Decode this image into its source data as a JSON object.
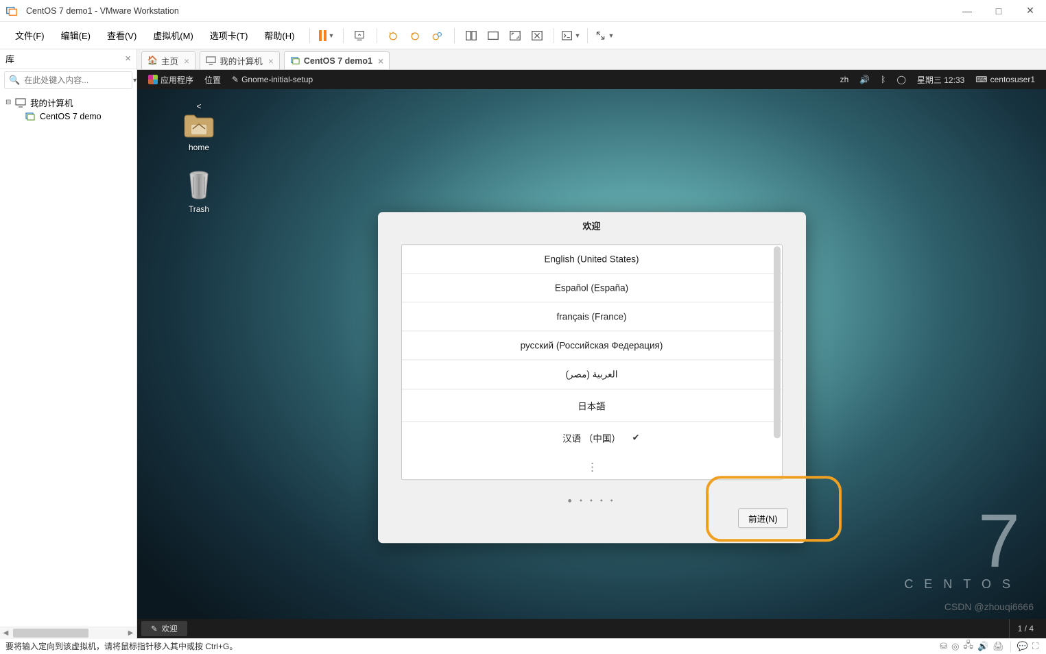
{
  "window": {
    "title": "CentOS 7 demo1 - VMware Workstation",
    "minimize": "—",
    "maximize": "□",
    "close": "✕"
  },
  "menu": {
    "file": "文件(F)",
    "edit": "编辑(E)",
    "view": "查看(V)",
    "vm": "虚拟机(M)",
    "tabs": "选项卡(T)",
    "help": "帮助(H)"
  },
  "sidebar": {
    "title": "库",
    "search_placeholder": "在此处键入内容...",
    "root": "我的计算机",
    "vm_name": "CentOS 7 demo"
  },
  "tabs": {
    "home": "主页",
    "mycomputer": "我的计算机",
    "centos": "CentOS 7 demo1"
  },
  "gnome_top": {
    "apps": "应用程序",
    "places": "位置",
    "process": "Gnome-initial-setup",
    "lang_ind": "zh",
    "day_time": "星期三 12:33",
    "user": "centosuser1"
  },
  "desktop_icons": {
    "home": "home",
    "trash": "Trash"
  },
  "centos_brand": {
    "seven": "7",
    "word": "CENTOS"
  },
  "welcome": {
    "title": "欢迎",
    "languages": [
      "English (United States)",
      "Español (España)",
      "français (France)",
      "русский (Российская Федерация)",
      "العربية (مصر)",
      "日本語",
      "汉语 （中国）"
    ],
    "selected_index": 6,
    "more": "⋮",
    "dots": "● • • • •",
    "next": "前进(N)"
  },
  "gnome_bottom": {
    "task": "欢迎",
    "pager": "1 / 4"
  },
  "statusbar": {
    "hint": "要将输入定向到该虚拟机，请将鼠标指针移入其中或按 Ctrl+G。"
  },
  "watermark": "CSDN @zhouqi6666"
}
